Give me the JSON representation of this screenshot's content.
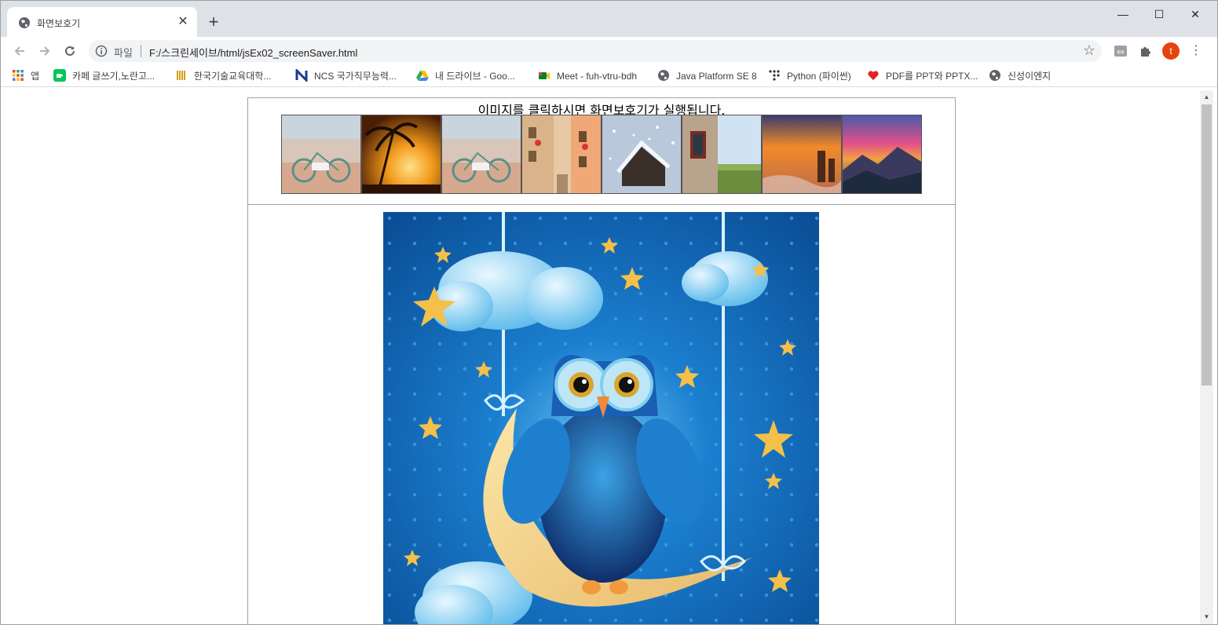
{
  "browser": {
    "tab": {
      "title": "화면보호기",
      "close_glyph": "✕"
    },
    "new_tab_glyph": "+",
    "window_controls": {
      "minimize": "—",
      "maximize": "☐",
      "close": "✕"
    },
    "address": {
      "scheme_label": "파일",
      "url": "F:/스크린세이브/html/jsEx02_screenSaver.html"
    },
    "profile_initial": "t",
    "bookmarks": [
      {
        "label": "앱",
        "icon": "apps-grid-icon"
      },
      {
        "label": "카페 글쓰기,노란고...",
        "icon": "cafe-icon"
      },
      {
        "label": "한국기술교육대학...",
        "icon": "koreatech-icon"
      },
      {
        "label": "NCS 국가직무능력...",
        "icon": "ncs-icon"
      },
      {
        "label": "내 드라이브 - Goo...",
        "icon": "google-drive-icon"
      },
      {
        "label": "Meet - fuh-vtru-bdh",
        "icon": "google-meet-icon"
      },
      {
        "label": "Java Platform SE 8",
        "icon": "globe-icon"
      },
      {
        "label": "Python (파이썬)",
        "icon": "python-dots-icon"
      },
      {
        "label": "PDF를 PPT와 PPTX...",
        "icon": "heart-pdf-icon"
      },
      {
        "label": "신성이엔지",
        "icon": "globe-icon"
      }
    ]
  },
  "page": {
    "hint": "이미지를 클릭하시면 화면보호기가 실행됩니다.",
    "thumbnails": [
      {
        "subject": "bicycles-on-beach"
      },
      {
        "subject": "palm-tree-sunset"
      },
      {
        "subject": "bicycles-on-beach"
      },
      {
        "subject": "old-town-street"
      },
      {
        "subject": "snowy-cabin"
      },
      {
        "subject": "stone-cottage-window"
      },
      {
        "subject": "sunset-sea-rocks"
      },
      {
        "subject": "mountain-sunset"
      }
    ],
    "main_image": {
      "subject": "owl-on-crescent-moon"
    }
  },
  "colors": {
    "tabstrip": "#dee1e6",
    "omnibox": "#f1f3f4",
    "avatar": "#e8430d",
    "night_sky": "#0b63b6"
  }
}
